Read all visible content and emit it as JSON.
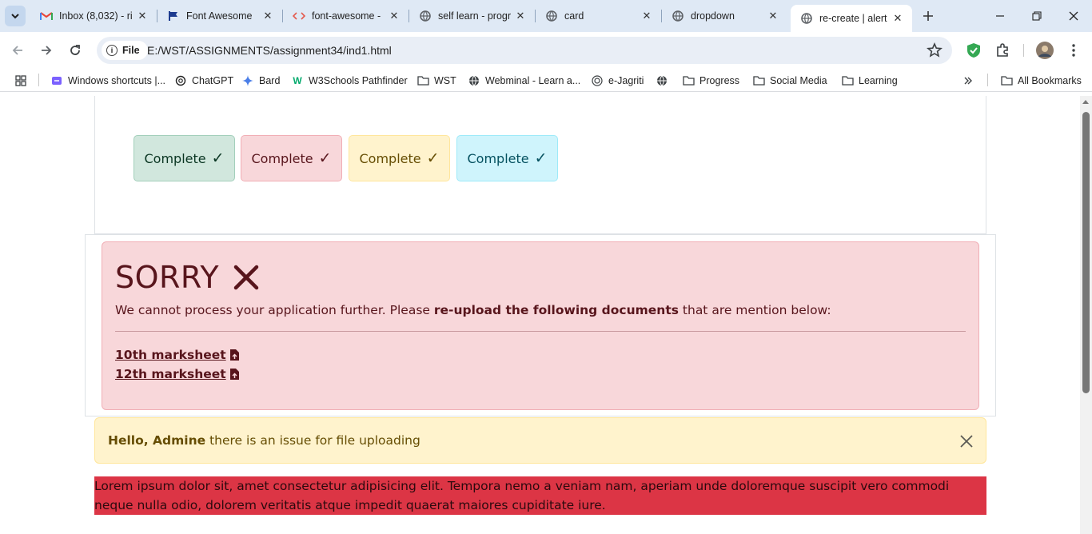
{
  "browser": {
    "tabs": [
      {
        "title": "Inbox (8,032) - ri",
        "favicon": "gmail-icon"
      },
      {
        "title": "Font Awesome",
        "favicon": "flag-icon"
      },
      {
        "title": "font-awesome -",
        "favicon": "code-icon"
      },
      {
        "title": "self learn - progr",
        "favicon": "globe-icon"
      },
      {
        "title": "card",
        "favicon": "globe-icon"
      },
      {
        "title": "dropdown",
        "favicon": "globe-icon"
      },
      {
        "title": "re-create | alert",
        "favicon": "globe-icon",
        "active": true
      }
    ],
    "address": {
      "chip_label": "File",
      "url": "E:/WST/ASSIGNMENTS/assignment34/ind1.html"
    },
    "bookmarks": [
      {
        "label": "Windows shortcuts |...",
        "icon": "bookmark-app-icon"
      },
      {
        "label": "ChatGPT",
        "icon": "chatgpt-icon"
      },
      {
        "label": "Bard",
        "icon": "sparkle-icon"
      },
      {
        "label": "W3Schools Pathfinder",
        "icon": "w3schools-icon"
      },
      {
        "label": "WST",
        "icon": "folder-icon"
      },
      {
        "label": "Webminal - Learn a...",
        "icon": "globe-icon"
      },
      {
        "label": "e-Jagriti",
        "icon": "ejagriti-icon"
      },
      {
        "label": "",
        "icon": "globe-icon"
      },
      {
        "label": "Progress",
        "icon": "folder-icon"
      },
      {
        "label": "Social Media",
        "icon": "folder-icon"
      },
      {
        "label": "Learning",
        "icon": "folder-icon"
      }
    ],
    "all_bookmarks": "All Bookmarks"
  },
  "page": {
    "badges": [
      {
        "label": "Complete",
        "variant": "success"
      },
      {
        "label": "Complete",
        "variant": "danger"
      },
      {
        "label": "Complete",
        "variant": "warning"
      },
      {
        "label": "Complete",
        "variant": "info"
      }
    ],
    "danger_alert": {
      "heading": "SORRY",
      "message_before": "We cannot process your application further. Please ",
      "message_bold": "re-upload the following documents",
      "message_after": " that are mention below:",
      "links": [
        "10th marksheet",
        "12th marksheet"
      ]
    },
    "warning_alert": {
      "bold": "Hello, Admine",
      "text": " there is an issue for file uploading"
    },
    "lorem": "Lorem ipsum dolor sit, amet consectetur adipisicing elit. Tempora nemo a veniam nam, aperiam unde doloremque suscipit vero commodi neque nulla odio, dolorem veritatis atque impedit quaerat maiores cupiditate iure."
  },
  "colors": {
    "success_bg": "#d1e7dd",
    "danger_bg": "#f8d7da",
    "warning_bg": "#fff3cd",
    "info_bg": "#cff4fc",
    "lorem_bg": "#dc3545"
  }
}
